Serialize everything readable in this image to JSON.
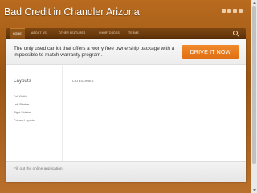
{
  "header": {
    "site_title": "Bad Credit in Chandler Arizona",
    "social_icons": [
      "twitter-icon",
      "facebook-icon",
      "google-plus-icon",
      "rss-icon"
    ]
  },
  "nav": {
    "items": [
      "Home",
      "About Us",
      "Other Features",
      "Shortcodes",
      "Terms"
    ]
  },
  "promo": {
    "text": "The only used car lot that offers a worry free ownership package with a impossible to match warranty program.",
    "button_label": "DRIVE IT NOW"
  },
  "sidebar": {
    "title": "Layouts",
    "links": [
      "Full Width",
      "Left Sidebar",
      "Right Sidebar",
      "Column Layouts"
    ]
  },
  "main": {
    "heading": "Categories"
  },
  "footer": {
    "link_text": "Fill out the online application."
  },
  "colors": {
    "page_background": "#9a5613",
    "button": "#e87a1d"
  }
}
